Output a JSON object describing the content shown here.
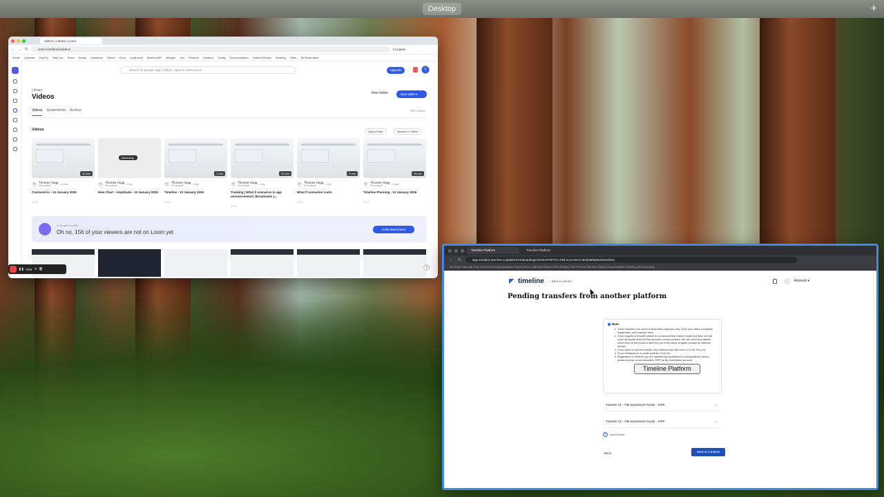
{
  "desktop": {
    "space_label": "Desktop",
    "add_space": "+"
  },
  "loom": {
    "tab_title": "Videos | Library | Loom",
    "url": "loom.com/looms/videos",
    "incognito": "Incognito",
    "bookmarks": [
      "Gmail",
      "Calendar",
      "HeyHQ",
      "Task List",
      "Scout",
      "Reddy",
      "Amplitude",
      "Retool",
      "Drive",
      "LogRocket",
      "BambooHR",
      "Webgen",
      "Jira",
      "Persona",
      "Sandbox",
      "Sanity",
      "Documentation",
      "Useful Dresses",
      "Reading",
      "Other",
      "All Bookmarks"
    ],
    "search_placeholder": "Search for people, tags, folders, Spaces, and Looms",
    "upgrade": "Upgrade",
    "avatar_initial": "T",
    "library_label": "Library",
    "page_title": "Videos",
    "new_folder": "New folder",
    "new_video": "New video",
    "tabs": [
      "Videos",
      "Screenshots",
      "Archive"
    ],
    "count": "596 videos",
    "section_title": "Videos",
    "sort1": "Upload date",
    "sort2": "Newest to Oldest",
    "videos": [
      {
        "owner": "Thomas Hogg",
        "time": "6 hours",
        "status": "Not shared",
        "title": "Customer.io - 14 January 2026",
        "duration": "40 sec",
        "stats": "0  0  0"
      },
      {
        "owner": "Thomas Hogg",
        "time": "1 day",
        "status": "Not shared",
        "title": "New Chart - Amplitude - 13 January 2026",
        "duration": "",
        "uploading": "Uploading...",
        "stats": ""
      },
      {
        "owner": "Thomas Hogg",
        "time": "1 day",
        "status": "Not shared",
        "title": "Timeline - 13 January 2026",
        "duration": "1 min",
        "stats": "1  0  0"
      },
      {
        "owner": "Thomas Hogg",
        "time": "1 day",
        "status": "Not shared",
        "title": "Tracking | What if scenarios in app announcement | Broadcasts |...",
        "duration": "30 sec",
        "stats": "0  0  0"
      },
      {
        "owner": "Thomas Hogg",
        "time": "1 day",
        "status": "Not shared",
        "title": "What if scenarios Loom",
        "duration": "3 min",
        "stats": "4  0  0"
      },
      {
        "owner": "Thomas Hogg",
        "time": "2 days",
        "status": "Not shared",
        "title": "Timeline Planning - 13 January 2026",
        "duration": "26 sec",
        "stats": "0  0  0"
      }
    ],
    "banner": {
      "small": "In the past 6 months",
      "text": "Oh no, 156 of your viewers are not on Loom yet",
      "button": "Invite teammates"
    },
    "recorder_time": "0:00",
    "help": "?"
  },
  "timeline": {
    "tab1": "Timeline Platform",
    "tab2": "Timeline Platform",
    "url": "app-sandbox.timeline.co/platform/onboarding/client/c970d776-c76d-4c14-8a74-ded338fa8251/transfers",
    "bookmarks": "All Gmail  Calendar  Task List  Scout  Reddy  Amplitude  Retool  Drive  LogRocket  BambooHR  Webgen  Jira  Persona  Sandbox  Sanity  Documentation  Reading  All Bookmarks",
    "logo": "timeline",
    "back_to_clients": "Back to clients",
    "account": "Account",
    "page_title": "Pending transfers from another platform",
    "note_title": "Note",
    "note_items": [
      "These transfers are used for illustrative purposes only. Once your client completes registration, we'll execute them.",
      "If you request to transfer assets to an account that holds a model portfolio, we will move all assets which fit this account's model portfolio. We will move any assets which don't fit the model to the Flex pot of the same wrapper (except for offshore bonds).",
      "If you select in specie transfer, any residual cash will come in to the Flex pot.",
      "If you rebalance to a model portfolio, it will be...",
      "Regardless of whether you are transferring crystallised or uncrystallised assets, please choose an accumulation SIPP as the destination account."
    ],
    "tooltip": "Timeline Platform",
    "transfers": [
      "Transfer #1 - 7IM Investment Funds - SIPP",
      "Transfer #2 - 7IM Investment Funds - SIPP"
    ],
    "add_transfer": "Add transfer",
    "back": "Back",
    "save": "Save & Continue"
  }
}
